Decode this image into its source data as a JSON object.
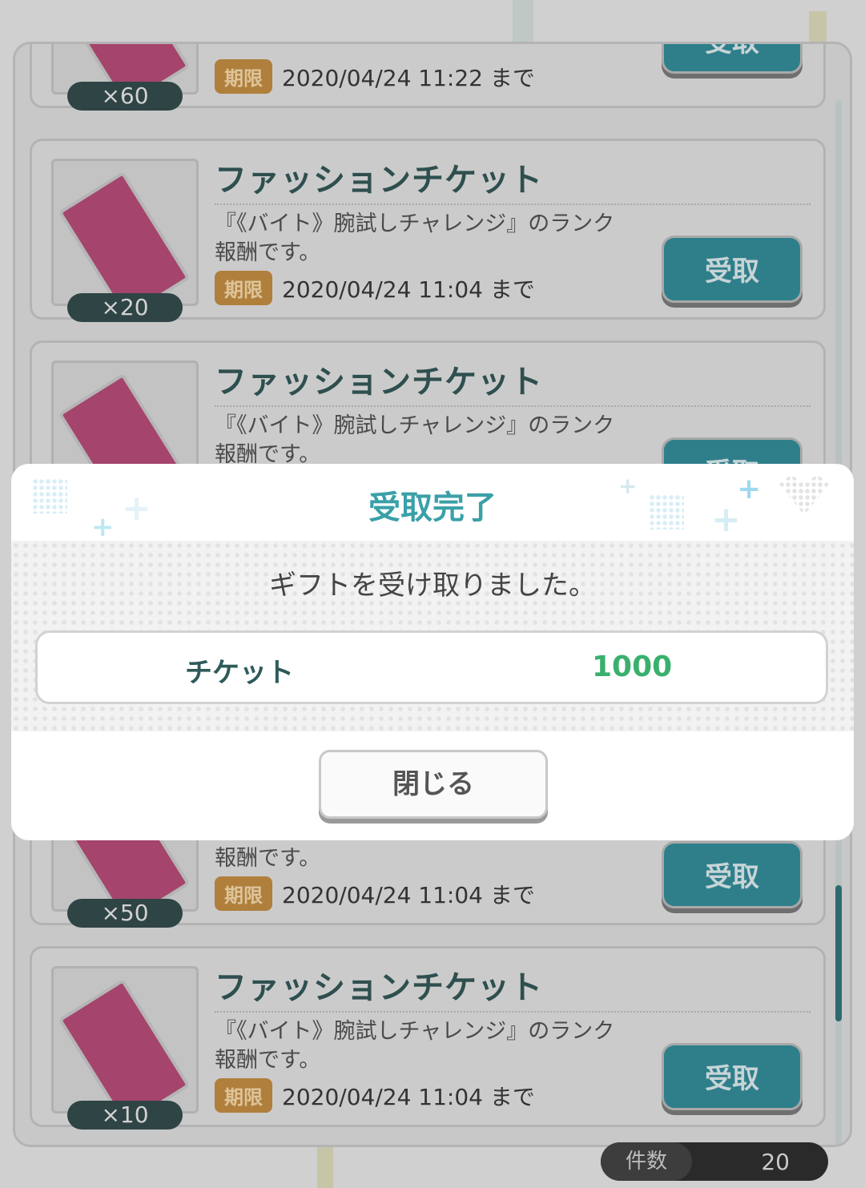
{
  "gift_list": {
    "items": [
      {
        "name": "",
        "desc_line1": "",
        "desc_line2": "",
        "qty": "×60",
        "deadline_label": "期限",
        "deadline": "2020/04/24 11:22 まで",
        "button": "受取"
      },
      {
        "name": "ファッションチケット",
        "desc_line1": "『《バイト》腕試しチャレンジ』のランク",
        "desc_line2": "報酬です。",
        "qty": "×20",
        "deadline_label": "期限",
        "deadline": "2020/04/24 11:04 まで",
        "button": "受取"
      },
      {
        "name": "ファッションチケット",
        "desc_line1": "『《バイト》腕試しチャレンジ』のランク",
        "desc_line2": "報酬です。",
        "qty": "",
        "deadline_label": "",
        "deadline": "",
        "button": "受取"
      },
      {
        "name": "",
        "desc_line1": "",
        "desc_line2": "報酬です。",
        "qty": "×50",
        "deadline_label": "期限",
        "deadline": "2020/04/24 11:04 まで",
        "button": "受取"
      },
      {
        "name": "ファッションチケット",
        "desc_line1": "『《バイト》腕試しチャレンジ』のランク",
        "desc_line2": "報酬です。",
        "qty": "×10",
        "deadline_label": "期限",
        "deadline": "2020/04/24 11:04 まで",
        "button": "受取"
      }
    ],
    "count_label": "件数",
    "count_value": "20"
  },
  "modal": {
    "title": "受取完了",
    "message": "ギフトを受け取りました。",
    "reward_name": "チケット",
    "reward_amount": "1000",
    "close_label": "閉じる"
  },
  "colors": {
    "accent_teal": "#3aa0a8",
    "reward_green": "#39b06d",
    "deadline_badge": "#b07f3c"
  }
}
